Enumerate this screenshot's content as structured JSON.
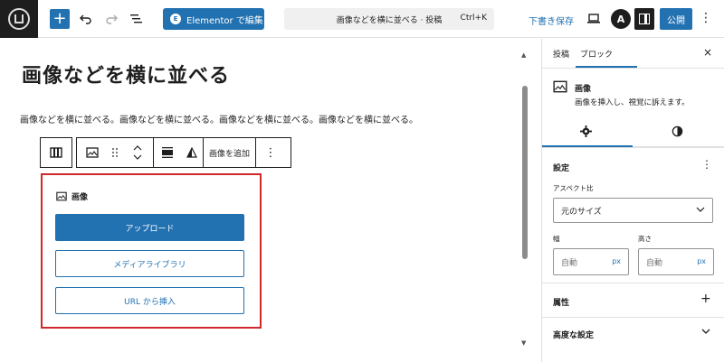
{
  "topbar": {
    "add_label": "+",
    "elementor_button": "Elementor で編集",
    "command_text": "画像などを横に並べる · 投稿",
    "command_shortcut": "Ctrl+K",
    "save_draft": "下書き保存",
    "astra_label": "A",
    "publish": "公開",
    "more": "⋮"
  },
  "editor": {
    "title": "画像などを横に並べる",
    "paragraph": "画像などを横に並べる。画像などを横に並べる。画像などを横に並べる。画像などを横に並べる。",
    "toolbar": {
      "add_image": "画像を追加",
      "more": "⋮"
    },
    "image_block": {
      "label": "画像",
      "upload": "アップロード",
      "media_library": "メディアライブラリ",
      "insert_url": "URL から挿入"
    }
  },
  "sidebar": {
    "tab_post": "投稿",
    "tab_block": "ブロック",
    "close": "×",
    "block_title": "画像",
    "block_desc": "画像を挿入し、視覚に訴えます。",
    "section_settings": "設定",
    "more": "⋮",
    "aspect_label": "アスペクト比",
    "aspect_value": "元のサイズ",
    "width_label": "幅",
    "height_label": "高さ",
    "width_value": "自動",
    "height_value": "自動",
    "unit": "px",
    "section_attributes": "属性",
    "attr_plus": "+",
    "section_advanced": "高度な設定"
  },
  "colors": {
    "accent": "#2271b1",
    "selection": "#d1282b",
    "dark": "#1e1e1e"
  }
}
